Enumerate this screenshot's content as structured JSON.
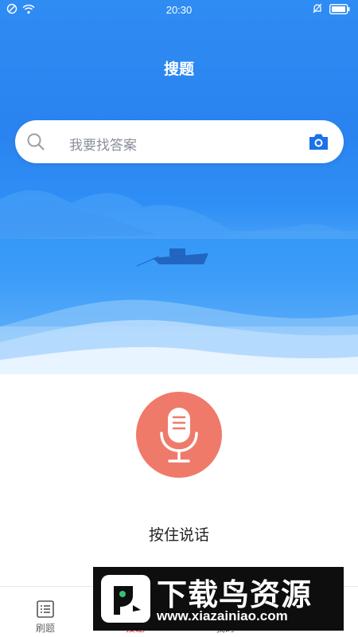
{
  "status_bar": {
    "time": "20:30",
    "icons": [
      "do-not-disturb-icon",
      "wifi-icon",
      "silent-bell-icon",
      "battery-icon"
    ]
  },
  "header": {
    "title": "搜题"
  },
  "search": {
    "placeholder": "我要找答案",
    "left_icon": "search-icon",
    "right_icon": "camera-icon"
  },
  "voice": {
    "hint": "按住说话",
    "icon": "microphone-icon"
  },
  "tab_bar": {
    "items": [
      {
        "label": "刷题",
        "icon": "list-icon",
        "active": false
      },
      {
        "label": "搜题",
        "icon": "search-icon",
        "active": true
      },
      {
        "label": "我的",
        "icon": "user-icon",
        "active": false
      },
      {
        "label": "",
        "icon": "more-icon",
        "active": false
      }
    ]
  },
  "watermark": {
    "title": "下载鸟资源",
    "url": "www.xiazainiao.com"
  },
  "colors": {
    "accent_blue": "#2a83f0",
    "mic_red": "#ef7a6a",
    "camera_blue": "#1a73e8",
    "active_tab": "#ee3a3a"
  }
}
